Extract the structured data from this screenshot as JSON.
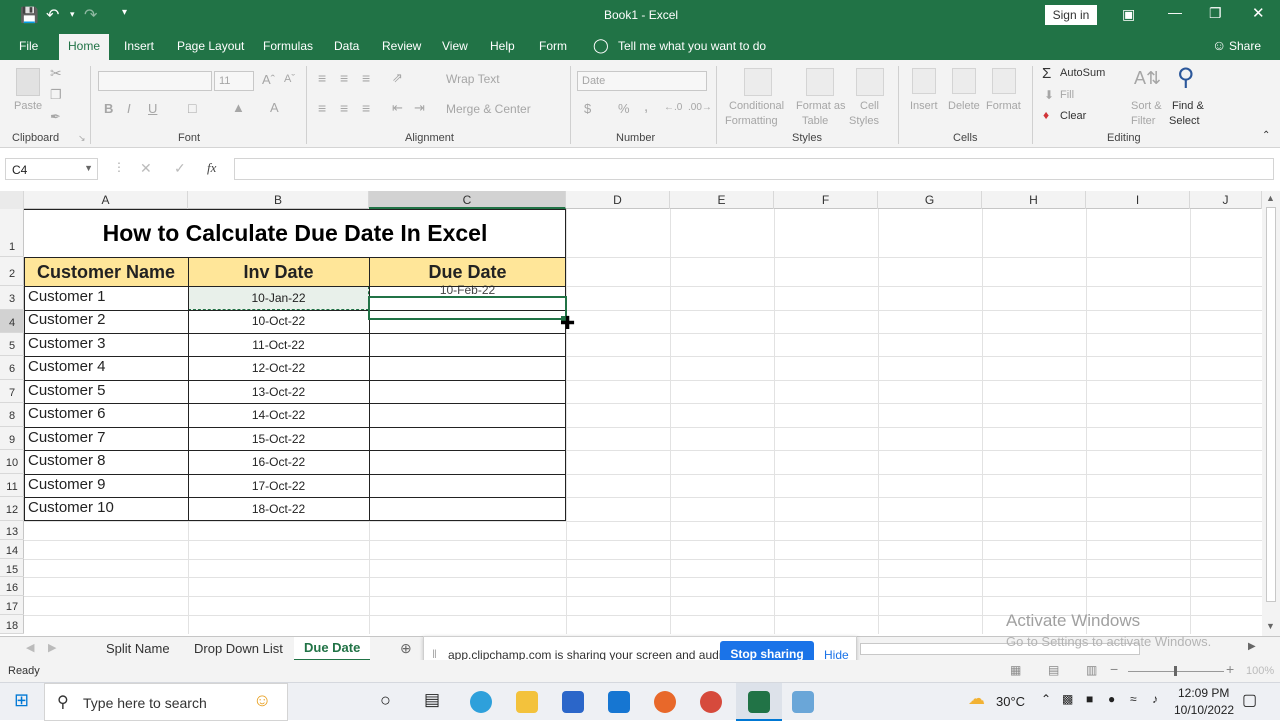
{
  "title_bar": {
    "title": "Book1  -  Excel",
    "sign_in": "Sign in"
  },
  "tabs": [
    "File",
    "Home",
    "Insert",
    "Page Layout",
    "Formulas",
    "Data",
    "Review",
    "View",
    "Help",
    "Form"
  ],
  "tell_me": "Tell me what you want to do",
  "share": "Share",
  "ribbon": {
    "paste": "Paste",
    "clipboard": "Clipboard",
    "font_size": "11",
    "bold": "B",
    "italic": "I",
    "underline": "U",
    "font_group": "Font",
    "wrap_text": "Wrap Text",
    "merge_center": "Merge & Center",
    "alignment": "Alignment",
    "number_format": "Date",
    "currency": "$",
    "percent": "%",
    "comma": ",",
    "number": "Number",
    "cond_fmt_1": "Conditional",
    "cond_fmt_2": "Formatting",
    "fmt_table_1": "Format as",
    "fmt_table_2": "Table",
    "cell_styles_1": "Cell",
    "cell_styles_2": "Styles",
    "styles": "Styles",
    "insert": "Insert",
    "delete": "Delete",
    "format": "Format",
    "cells": "Cells",
    "autosum": "AutoSum",
    "fill": "Fill",
    "clear": "Clear",
    "sort_1": "Sort &",
    "sort_2": "Filter",
    "find_1": "Find &",
    "find_2": "Select",
    "editing": "Editing"
  },
  "formula_bar": {
    "name_box": "C4",
    "fx": "fx",
    "formula": ""
  },
  "columns": [
    "A",
    "B",
    "C",
    "D",
    "E",
    "F",
    "G",
    "H",
    "I",
    "J"
  ],
  "rows": [
    "1",
    "2",
    "3",
    "4",
    "5",
    "6",
    "7",
    "8",
    "9",
    "10",
    "11",
    "12",
    "13",
    "14",
    "15",
    "16",
    "17",
    "18"
  ],
  "sheet_title": "How to Calculate Due Date In Excel",
  "headers": {
    "a": "Customer Name",
    "b": "Inv Date",
    "c": "Due Date"
  },
  "table": [
    {
      "name": "Customer 1",
      "inv": "10-Jan-22",
      "due": "10-Feb-22"
    },
    {
      "name": "Customer 2",
      "inv": "10-Oct-22",
      "due": ""
    },
    {
      "name": "Customer 3",
      "inv": "11-Oct-22",
      "due": ""
    },
    {
      "name": "Customer 4",
      "inv": "12-Oct-22",
      "due": ""
    },
    {
      "name": "Customer 5",
      "inv": "13-Oct-22",
      "due": ""
    },
    {
      "name": "Customer 6",
      "inv": "14-Oct-22",
      "due": ""
    },
    {
      "name": "Customer 7",
      "inv": "15-Oct-22",
      "due": ""
    },
    {
      "name": "Customer 8",
      "inv": "16-Oct-22",
      "due": ""
    },
    {
      "name": "Customer 9",
      "inv": "17-Oct-22",
      "due": ""
    },
    {
      "name": "Customer 10",
      "inv": "18-Oct-22",
      "due": ""
    }
  ],
  "sheet_tabs": [
    "Split Name",
    "Drop Down List",
    "Due Date"
  ],
  "active_sheet": "Due Date",
  "watermark": {
    "line1": "Activate Windows",
    "line2": "Go to Settings to activate Windows."
  },
  "share_bar": {
    "text": "app.clipchamp.com is sharing your screen and audio.",
    "stop": "Stop sharing",
    "hide": "Hide"
  },
  "status": {
    "ready": "Ready",
    "zoom": "100%"
  },
  "taskbar": {
    "search": "Type here to search",
    "temp": "30°C",
    "time": "12:09 PM",
    "date": "10/10/2022"
  },
  "colors": {
    "excel_green": "#217346",
    "header_fill": "#ffe699",
    "share_blue": "#1a73e8"
  }
}
